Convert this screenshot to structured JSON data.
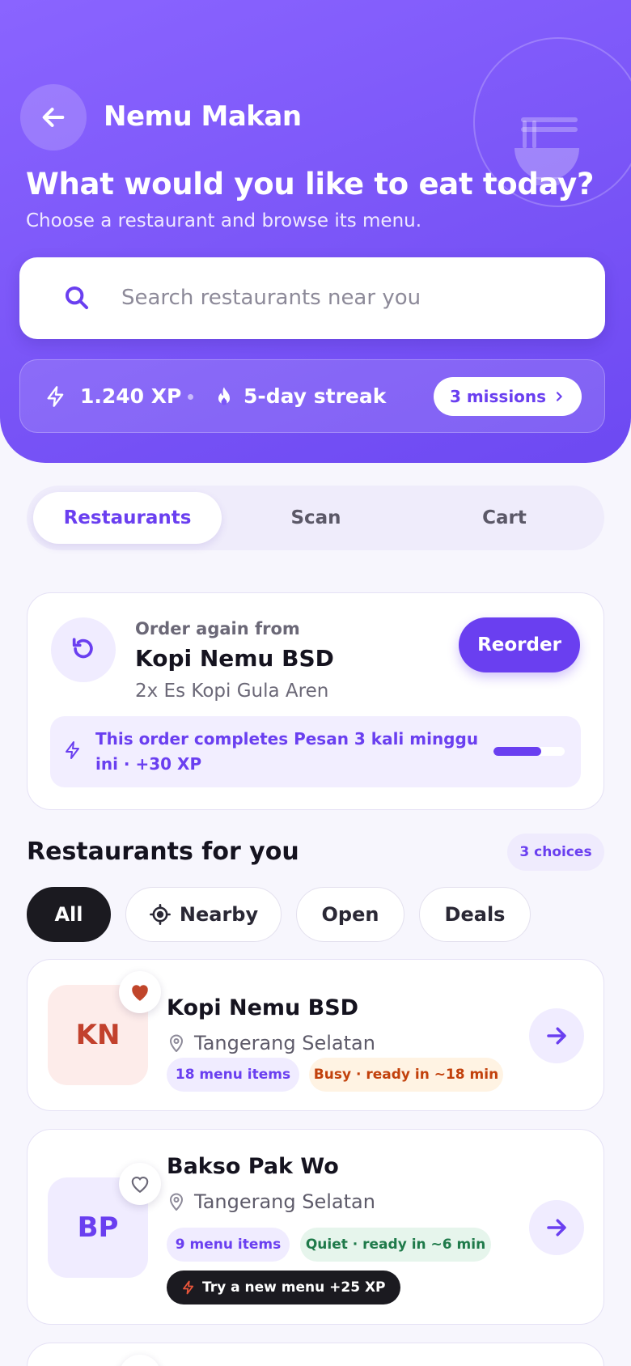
{
  "app": {
    "title": "Nemu Makan"
  },
  "hero": {
    "title": "What would you like to eat today?",
    "subtitle": "Choose a restaurant and browse its menu."
  },
  "search": {
    "placeholder": "Search restaurants near you",
    "value": ""
  },
  "gamification": {
    "xp": "1.240 XP",
    "streak": "5-day streak",
    "missions_label": "3 missions"
  },
  "tabs": [
    {
      "label": "Restaurants",
      "active": true
    },
    {
      "label": "Scan",
      "active": false
    },
    {
      "label": "Cart",
      "active": false
    }
  ],
  "reorder": {
    "eyebrow": "Order again from",
    "restaurant": "Kopi Nemu BSD",
    "items": "2x Es Kopi Gula Aren",
    "button": "Reorder",
    "mission_text": "This order completes Pesan 3 kali minggu ini · +30 XP",
    "mission_progress": 0.67
  },
  "restaurants_section": {
    "title": "Restaurants for you",
    "badge": "3 choices",
    "filters": [
      {
        "label": "All",
        "active": true,
        "icon": ""
      },
      {
        "label": "Nearby",
        "active": false,
        "icon": "crosshair-icon"
      },
      {
        "label": "Open",
        "active": false,
        "icon": ""
      },
      {
        "label": "Deals",
        "active": false,
        "icon": ""
      }
    ]
  },
  "restaurants": [
    {
      "initials": "KN",
      "name": "Kopi Nemu BSD",
      "location": "Tangerang Selatan",
      "menu_count": "18 menu items",
      "status": "Busy · ready in ~18 min",
      "favorite": true,
      "promo": ""
    },
    {
      "initials": "BP",
      "name": "Bakso Pak Wo",
      "location": "Tangerang Selatan",
      "menu_count": "9 menu items",
      "status": "Quiet · ready in ~6 min",
      "favorite": false,
      "promo": "Try a new menu +25 XP"
    }
  ],
  "colors": {
    "brand": "#6a3ff0",
    "hero_start": "#8a64ff",
    "busy_text": "#c2410c",
    "busy_bg": "#fff3e3",
    "quiet_text": "#1f7a4a",
    "quiet_bg": "#e6f5ec",
    "kn_text": "#c2412d",
    "kn_bg": "#fdecea",
    "bp_text": "#6a3ff0",
    "bp_bg": "#f0ecff",
    "favorite": "#c0452a"
  }
}
